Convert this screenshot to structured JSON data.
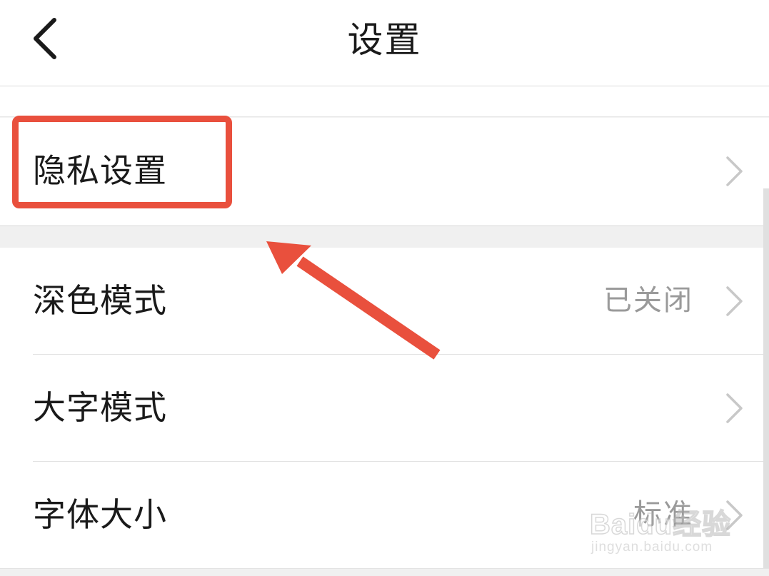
{
  "header": {
    "title": "设置",
    "back_icon": "chevron-left-icon"
  },
  "rows": [
    {
      "label": "隐私设置",
      "value": "",
      "chevron_icon": "chevron-right-icon"
    },
    {
      "label": "深色模式",
      "value": "已关闭",
      "chevron_icon": "chevron-right-icon"
    },
    {
      "label": "大字模式",
      "value": "",
      "chevron_icon": "chevron-right-icon"
    },
    {
      "label": "字体大小",
      "value": "标准",
      "chevron_icon": "chevron-right-icon"
    }
  ],
  "annotation": {
    "color": "#e9503d",
    "highlighted_item": "隐私设置"
  },
  "watermark": {
    "brand": "Baidu经验",
    "url": "jingyan.baidu.com"
  },
  "colors": {
    "background": "#f2f2f2",
    "row_background": "#ffffff",
    "text_primary": "#1a1a1a",
    "text_secondary": "#9a9a9a",
    "chevron": "#c8c8c8"
  }
}
